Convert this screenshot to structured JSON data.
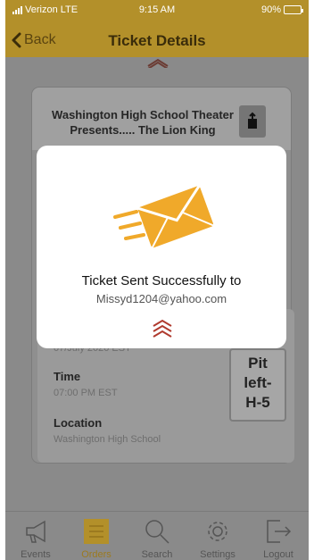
{
  "status_bar": {
    "carrier": "Verizon LTE",
    "time": "9:15 AM",
    "battery": "90%",
    "battery_level": 0.9
  },
  "nav": {
    "back_label": "Back",
    "title": "Ticket Details"
  },
  "ticket": {
    "event_title": "Washington High School Theater Presents..... The Lion King",
    "date_partial": "07/July 2020 EST",
    "time_label": "Time",
    "time_value": "07:00 PM EST",
    "location_label": "Location",
    "location_value": "Washington High School",
    "seat_lines": [
      "Pit",
      "left-",
      "H-5"
    ]
  },
  "modal": {
    "message": "Ticket Sent Successfully to",
    "email": "Missyd1204@yahoo.com"
  },
  "tabs": [
    {
      "label": "Events",
      "icon": "megaphone-icon"
    },
    {
      "label": "Orders",
      "icon": "list-icon"
    },
    {
      "label": "Search",
      "icon": "search-icon"
    },
    {
      "label": "Settings",
      "icon": "gear-icon"
    },
    {
      "label": "Logout",
      "icon": "logout-icon"
    }
  ],
  "active_tab": "Orders",
  "colors": {
    "header": "#b3902a",
    "accent": "#f0a92a",
    "overlay": "#8a8a8a",
    "chevron": "#b03a2e"
  }
}
